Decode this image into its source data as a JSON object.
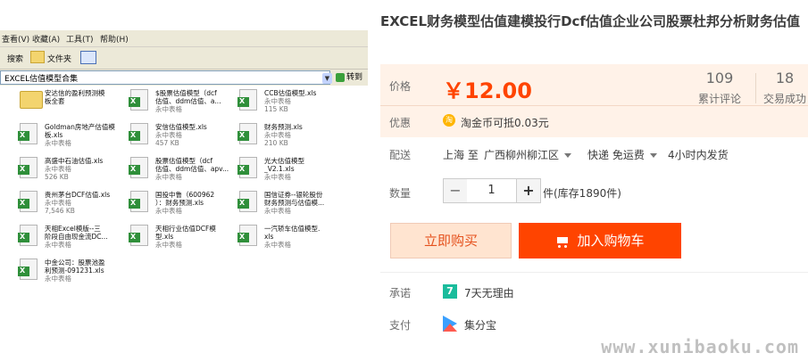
{
  "explorer": {
    "menu": [
      "查看(V)",
      "收藏(A)",
      "工具(T)",
      "帮助(H)"
    ],
    "toolbar": {
      "search": "搜索",
      "folders": "文件夹"
    },
    "address": "EXCEL估值模型合集",
    "go": "转到",
    "files": [
      {
        "name": "安达信的盈利预测模\n板全套",
        "meta": "",
        "type": "folder"
      },
      {
        "name": "$股票估值模型（dcf\n估值、ddm估值、a...",
        "meta": "永中表格",
        "type": "xls"
      },
      {
        "name": "CCB估值模型.xls",
        "meta": "永中表格\n115 KB",
        "type": "xls"
      },
      {
        "name": "Goldman房地产估值模\n板.xls",
        "meta": "永中表格",
        "type": "xls"
      },
      {
        "name": "安信估值模型.xls",
        "meta": "永中表格\n457 KB",
        "type": "xls"
      },
      {
        "name": "财务预测.xls",
        "meta": "永中表格\n210 KB",
        "type": "xls"
      },
      {
        "name": "高盛中石油估值.xls",
        "meta": "永中表格\n526 KB",
        "type": "xls"
      },
      {
        "name": "股票估值模型（dcf\n估值、ddm估值、apv...",
        "meta": "永中表格",
        "type": "xls"
      },
      {
        "name": "光大估值模型\n_V2.1.xls",
        "meta": "永中表格",
        "type": "xls"
      },
      {
        "name": "贵州茅台DCF估值.xls",
        "meta": "永中表格\n7,546 KB",
        "type": "xls"
      },
      {
        "name": "国投中鲁（600962\n）：财务预测.xls",
        "meta": "永中表格",
        "type": "xls"
      },
      {
        "name": "国信证券--银轮股份\n财务预测与估值模...",
        "meta": "永中表格",
        "type": "xls"
      },
      {
        "name": "天相Excel模版--三\n阶段自由现金流DC...",
        "meta": "永中表格",
        "type": "xls"
      },
      {
        "name": "天相行业估值DCF模\n型.xls",
        "meta": "永中表格",
        "type": "xls"
      },
      {
        "name": "一汽轿车估值模型.\nxls",
        "meta": "永中表格",
        "type": "xls"
      },
      {
        "name": "中金公司：股票池盈\n利预测-091231.xls",
        "meta": "永中表格",
        "type": "xls"
      }
    ]
  },
  "product": {
    "title": "EXCEL财务模型估值建模投行Dcf估值企业公司股票杜邦分析财务估值",
    "price_label": "价格",
    "price": "￥12.00",
    "reviews_num": "109",
    "reviews_label": "累计评论",
    "sales_num": "18",
    "sales_label": "交易成功",
    "promo_label": "优惠",
    "coin_icon_text": "淘",
    "promo_text": "淘金币可抵0.03元",
    "ship_label": "配送",
    "ship_from": "上海 至",
    "ship_to": "广西柳州柳江区",
    "ship_method": "快递 免运费",
    "ship_time": "4小时内发货",
    "qty_label": "数量",
    "qty_minus": "−",
    "qty_value": "1",
    "qty_plus": "+",
    "stock": "件(库存1890件)",
    "buy_now": "立即购买",
    "add_cart": "加入购物车",
    "promise_label": "承诺",
    "promise_badge": "7",
    "promise_text": "7天无理由",
    "pay_label": "支付",
    "pay_text": "集分宝"
  },
  "watermark": "www.xunibaoku.com"
}
